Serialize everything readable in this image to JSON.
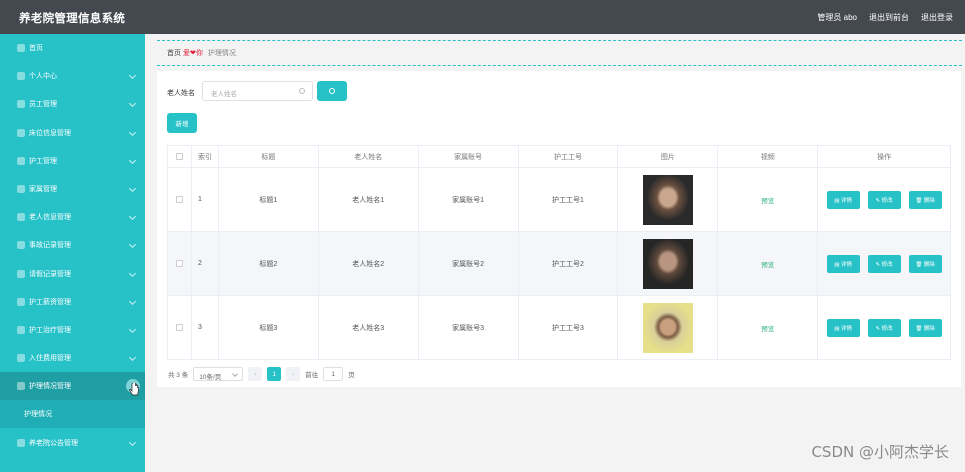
{
  "app": {
    "title": "养老院管理信息系统"
  },
  "top_nav": {
    "user": "管理员 abo",
    "back_home": "退出到前台",
    "logout": "退出登录"
  },
  "sidebar": {
    "items": [
      {
        "label": "首页",
        "expandable": false
      },
      {
        "label": "个人中心",
        "expandable": true
      },
      {
        "label": "员工管理",
        "expandable": true
      },
      {
        "label": "床位信息管理",
        "expandable": true
      },
      {
        "label": "护工管理",
        "expandable": true
      },
      {
        "label": "家属管理",
        "expandable": true
      },
      {
        "label": "老人信息管理",
        "expandable": true
      },
      {
        "label": "事故记录管理",
        "expandable": true
      },
      {
        "label": "请假记录管理",
        "expandable": true
      },
      {
        "label": "护工薪资管理",
        "expandable": true
      },
      {
        "label": "护工治疗管理",
        "expandable": true
      },
      {
        "label": "入住费用管理",
        "expandable": true
      },
      {
        "label": "护理情况管理",
        "expandable": true,
        "active": true
      }
    ],
    "sub_item": "护理情况",
    "last_item": "养老院公告管理"
  },
  "breadcrumb": {
    "home": "首页",
    "heart": "爱❤你",
    "current": "护理情况"
  },
  "search": {
    "label": "老人姓名",
    "placeholder": "老人姓名"
  },
  "buttons": {
    "add": "新增"
  },
  "table": {
    "headers": [
      "索引",
      "标题",
      "老人姓名",
      "家属账号",
      "护工工号",
      "图片",
      "视频",
      "操作"
    ],
    "rows": [
      {
        "index": "1",
        "title": "标题1",
        "elder": "老人姓名1",
        "family": "家属账号1",
        "worker": "护工工号1",
        "video": "预览"
      },
      {
        "index": "2",
        "title": "标题2",
        "elder": "老人姓名2",
        "family": "家属账号2",
        "worker": "护工工号2",
        "video": "预览"
      },
      {
        "index": "3",
        "title": "标题3",
        "elder": "老人姓名3",
        "family": "家属账号3",
        "worker": "护工工号3",
        "video": "预览"
      }
    ],
    "actions": {
      "detail": "▤ 详情",
      "edit": "✎ 修改",
      "delete": "🗑 删除"
    }
  },
  "pagination": {
    "total": "共 3 条",
    "page_size": "10条/页",
    "current_page": "1",
    "goto_prefix": "前往",
    "goto_value": "1",
    "goto_suffix": "页"
  },
  "watermark": "CSDN @小阿杰学长"
}
